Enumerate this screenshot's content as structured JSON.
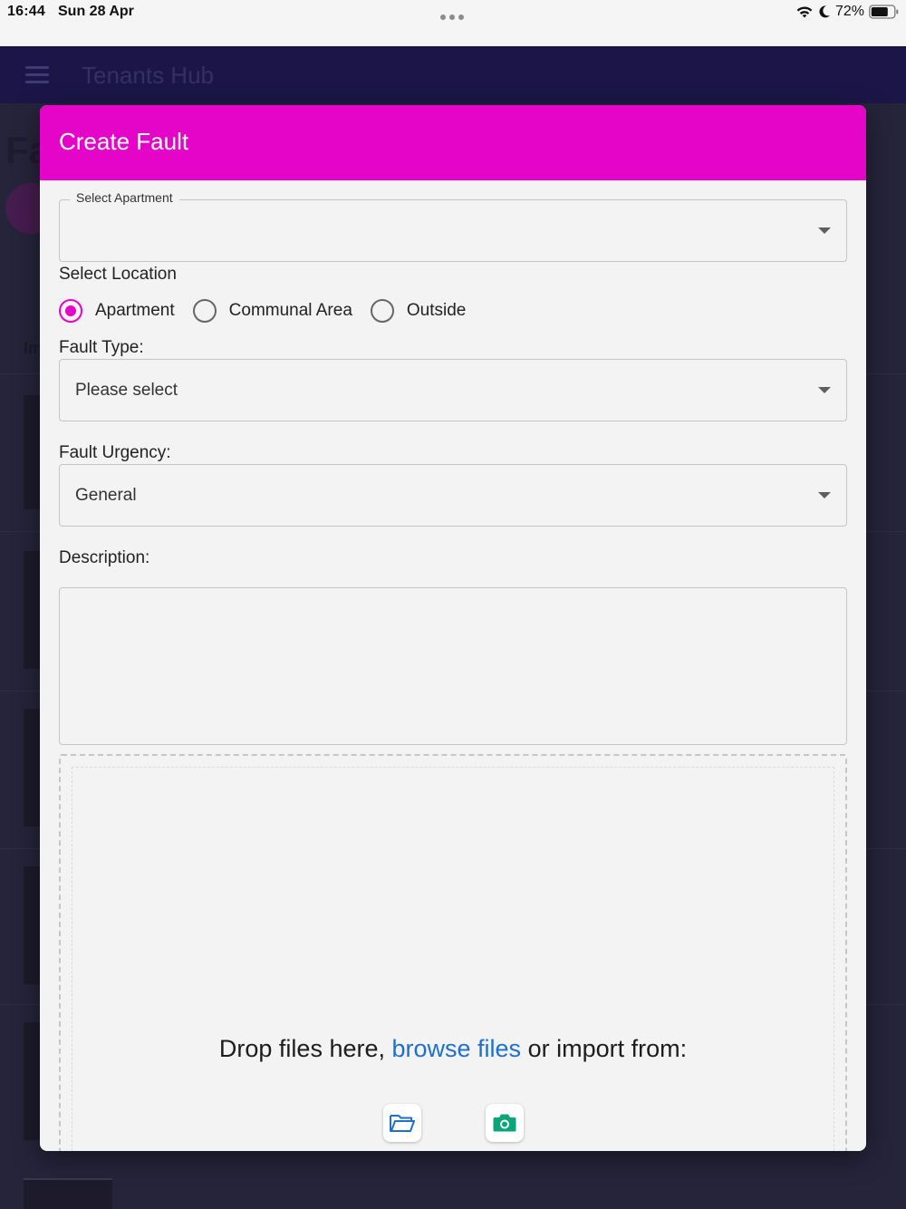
{
  "status_bar": {
    "time": "16:44",
    "date": "Sun 28 Apr",
    "battery_percent": "72%"
  },
  "app": {
    "title": "Tenants Hub",
    "page_title_partial": "Fa",
    "bg_label_partial": "Im"
  },
  "modal": {
    "title": "Create Fault",
    "select_apartment": {
      "legend": "Select Apartment",
      "value": ""
    },
    "location": {
      "label": "Select Location",
      "options": [
        {
          "label": "Apartment",
          "checked": true
        },
        {
          "label": "Communal Area",
          "checked": false
        },
        {
          "label": "Outside",
          "checked": false
        }
      ]
    },
    "fault_type": {
      "label": "Fault Type:",
      "value": "Please select"
    },
    "fault_urgency": {
      "label": "Fault Urgency:",
      "value": "General"
    },
    "description": {
      "label": "Description:",
      "value": ""
    },
    "dropzone": {
      "text_before": "Drop files here, ",
      "link": "browse files",
      "text_after": " or import from:",
      "sources": [
        {
          "name": "folder-icon",
          "color": "#1f6fcc"
        },
        {
          "name": "camera-icon",
          "color": "#0aa579"
        }
      ]
    }
  },
  "colors": {
    "accent": "#e405c8",
    "link": "#1f6fcc",
    "appbar": "#1b1647"
  }
}
